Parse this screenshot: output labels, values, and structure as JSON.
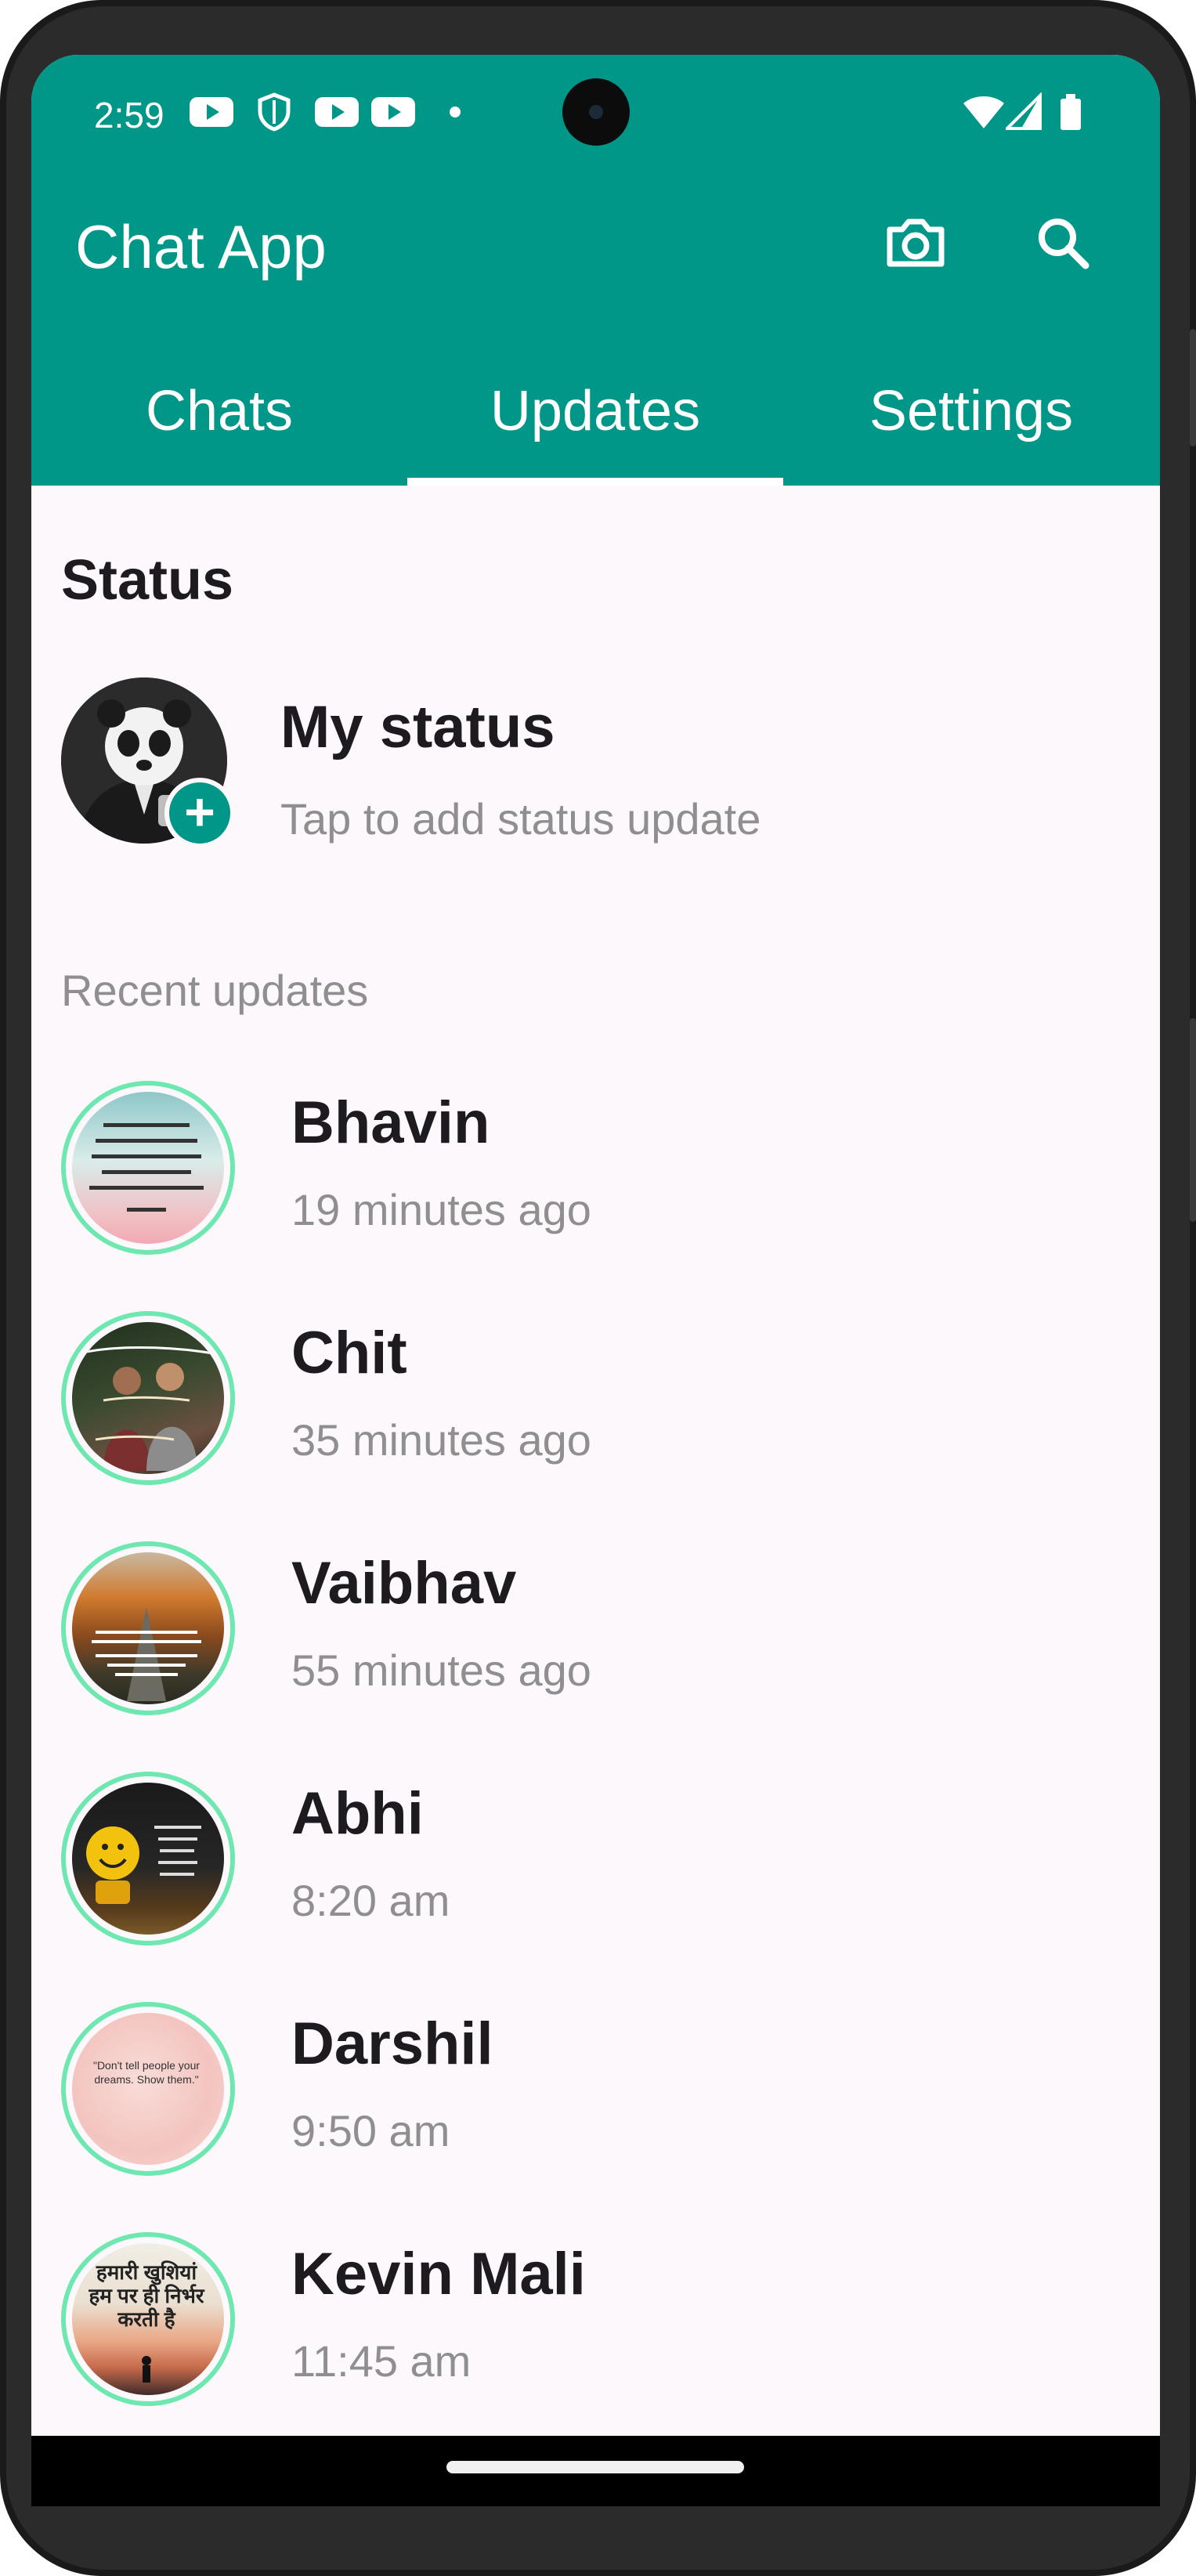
{
  "status_bar": {
    "time": "2:59",
    "icons": [
      "youtube-icon",
      "shield-icon",
      "youtube-icon",
      "youtube-icon",
      "dot-icon",
      "wifi-icon",
      "signal-icon",
      "battery-icon"
    ]
  },
  "app_bar": {
    "title": "Chat App",
    "actions": [
      "camera-icon",
      "search-icon"
    ],
    "color": "#009688"
  },
  "tabs": [
    {
      "label": "Chats",
      "selected": false
    },
    {
      "label": "Updates",
      "selected": true
    },
    {
      "label": "Settings",
      "selected": false
    }
  ],
  "status_section": {
    "title": "Status",
    "my_status": {
      "name": "My status",
      "subtitle": "Tap to add status update"
    },
    "recent_label": "Recent updates"
  },
  "updates": [
    {
      "name": "Bhavin",
      "time": "19 minutes ago"
    },
    {
      "name": "Chit",
      "time": "35 minutes ago"
    },
    {
      "name": "Vaibhav",
      "time": "55 minutes ago"
    },
    {
      "name": "Abhi",
      "time": "8:20 am"
    },
    {
      "name": "Darshil",
      "time": "9:50 am"
    },
    {
      "name": "Kevin Mali",
      "time": "11:45 am"
    }
  ],
  "thumbnail_text": {
    "darshil": "\"Don't tell people your dreams. Show them.\"",
    "kevin": "हमारी खुशियां हम पर ही निर्भर करती है"
  },
  "colors": {
    "accent": "#009688",
    "ring": "#6ee7b0",
    "background": "#fdf8fb"
  }
}
